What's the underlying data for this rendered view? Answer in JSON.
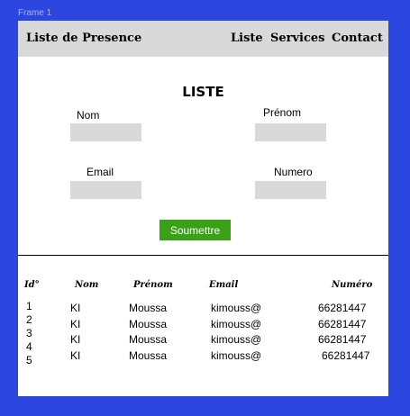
{
  "canvas": {
    "frame_label": "Frame 1"
  },
  "navbar": {
    "brand": "Liste de Presence",
    "links": [
      "Liste",
      "Services",
      "Contact"
    ]
  },
  "form": {
    "title": "LISTE",
    "fields": {
      "nom": {
        "label": "Nom",
        "value": ""
      },
      "prenom": {
        "label": "Prénom",
        "value": ""
      },
      "email": {
        "label": "Email",
        "value": ""
      },
      "numero": {
        "label": "Numero",
        "value": ""
      }
    },
    "submit_label": "Soumettre"
  },
  "table": {
    "headers": [
      "Id°",
      "Nom",
      "Prénom",
      "Email",
      "Numéro"
    ],
    "ids": [
      "1",
      "2",
      "3",
      "4",
      "5"
    ],
    "rows": [
      {
        "nom": "KI",
        "prenom": "Moussa",
        "email": "kimouss@",
        "numero": "66281447"
      },
      {
        "nom": "KI",
        "prenom": "Moussa",
        "email": "kimouss@",
        "numero": "66281447"
      },
      {
        "nom": "KI",
        "prenom": "Moussa",
        "email": "kimouss@",
        "numero": "66281447"
      },
      {
        "nom": "KI",
        "prenom": "Moussa",
        "email": "kimouss@",
        "numero": "66281447"
      }
    ]
  }
}
